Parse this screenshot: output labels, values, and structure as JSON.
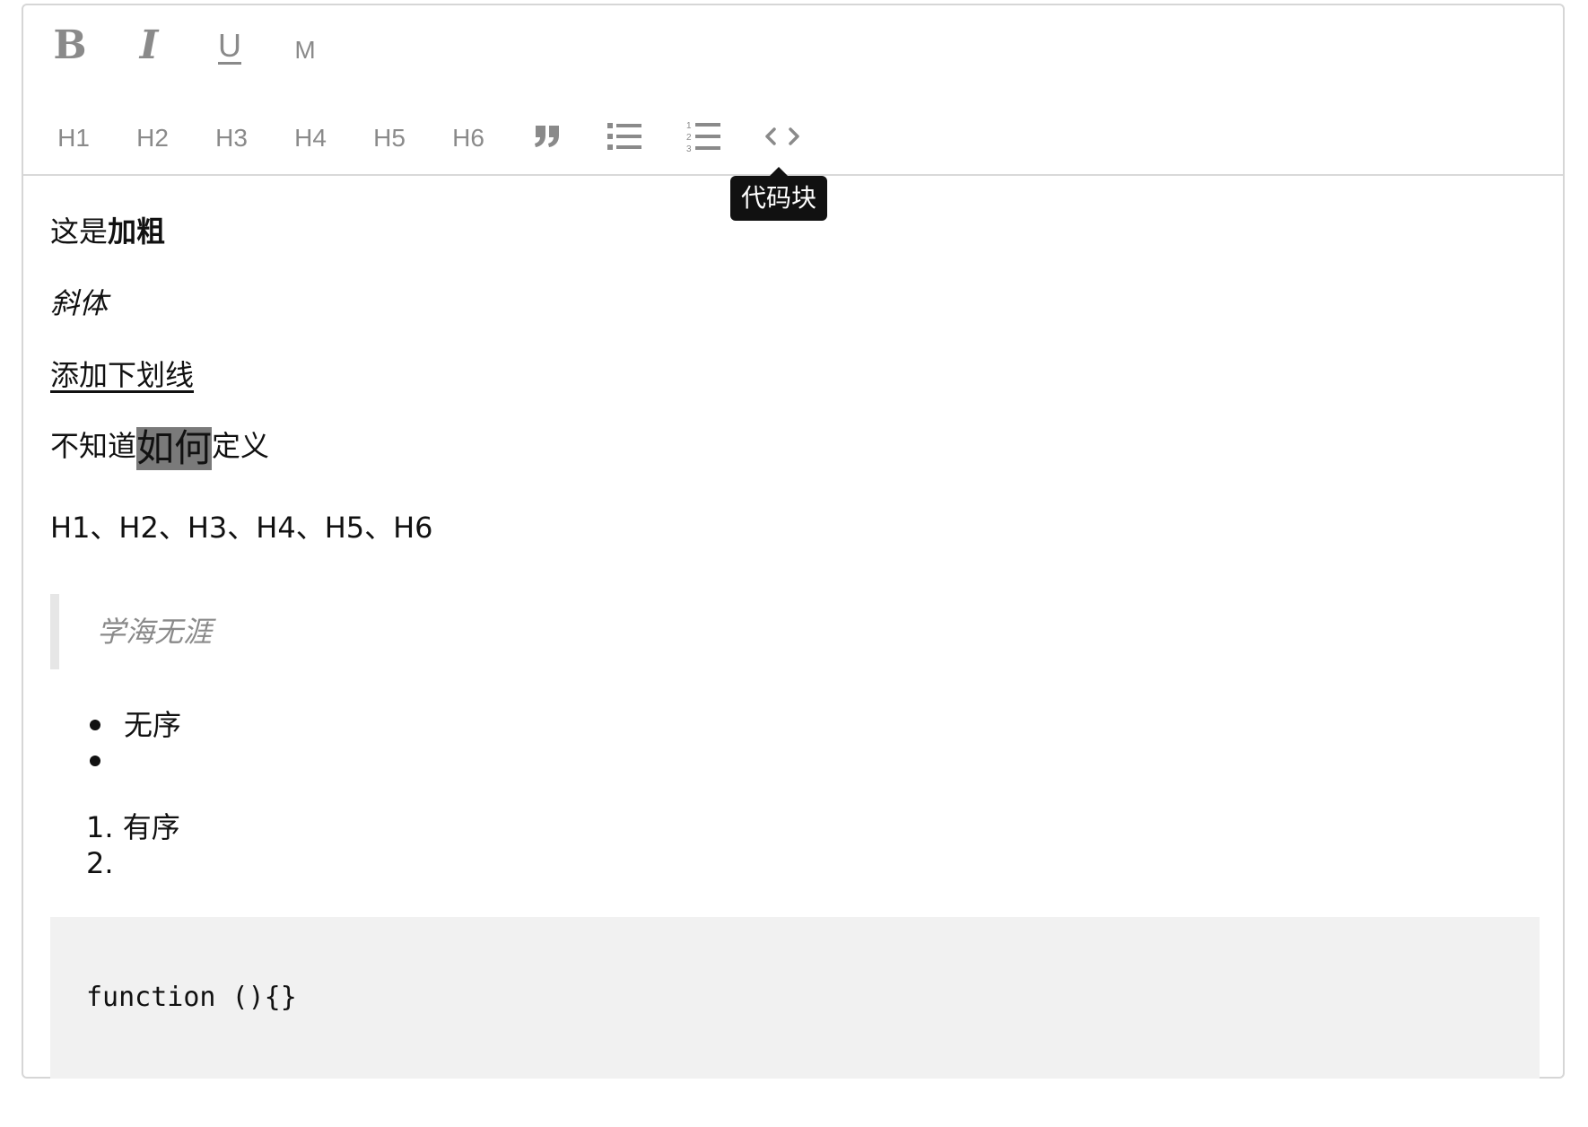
{
  "toolbar": {
    "bold_label": "B",
    "italic_label": "I",
    "underline_label": "U",
    "mark_label": "M",
    "headings": [
      "H1",
      "H2",
      "H3",
      "H4",
      "H5",
      "H6"
    ],
    "icons": {
      "quote": "quote-icon",
      "unordered_list": "unordered-list-icon",
      "ordered_list": "ordered-list-icon",
      "code": "code-icon"
    }
  },
  "tooltip": {
    "text": "代码块"
  },
  "content": {
    "bold_line_prefix": "这是",
    "bold_line_bold": "加粗",
    "italic_line": "斜体",
    "underline_line": "添加下划线",
    "mark_line_prefix": "不知道",
    "mark_line_marked": "如何",
    "mark_line_suffix": "定义",
    "headings_line": "H1、H2、H3、H4、H5、H6",
    "blockquote": "学海无涯",
    "unordered_list": [
      "无序",
      ""
    ],
    "ordered_list": [
      {
        "number": "1.",
        "text": "有序"
      },
      {
        "number": "2.",
        "text": ""
      }
    ],
    "code": "function (){}"
  },
  "colors": {
    "toolbar_icon": "#8a8a8a",
    "tooltip_bg": "#111111",
    "mark_bg": "#7a7a7a",
    "code_bg": "#f1f1f1",
    "blockquote_border": "#e6e6e6"
  }
}
